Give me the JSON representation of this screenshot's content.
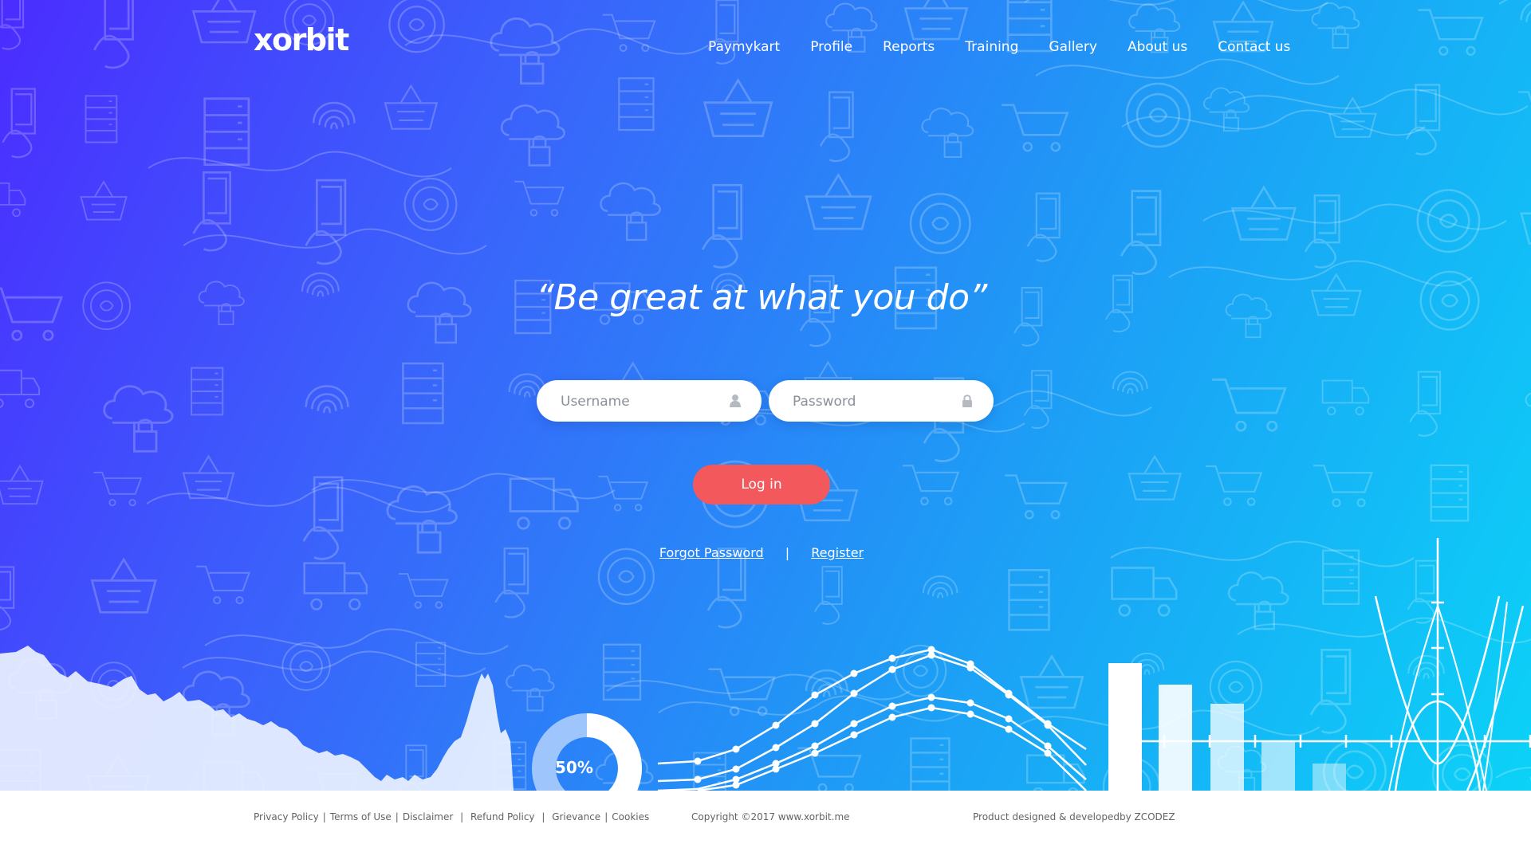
{
  "header": {
    "logo": "xorbit",
    "nav": [
      "Paymykart",
      "Profile",
      "Reports",
      "Training",
      "Gallery",
      "About us",
      "Contact us"
    ]
  },
  "hero": {
    "quote": "“Be great at what you do”"
  },
  "form": {
    "username_placeholder": "Username",
    "password_placeholder": "Password",
    "login_label": "Log in",
    "forgot_label": "Forgot Password",
    "separator": "|",
    "register_label": "Register"
  },
  "decor": {
    "donut_label": "50%"
  },
  "footer": {
    "links": [
      "Privacy Policy",
      "Terms of Use",
      "Disclaimer",
      "Refund Policy",
      "Grievance",
      "Cookies"
    ],
    "copyright": "Copyright ©2017 www.xorbit.me",
    "credit": "Product designed & developedby ZCODEZ"
  },
  "colors": {
    "gradient_start": "#4b2cff",
    "gradient_end": "#0bd2f7",
    "login_button": "#f2585c"
  },
  "icons": {
    "username": "user-icon",
    "password": "lock-icon"
  }
}
